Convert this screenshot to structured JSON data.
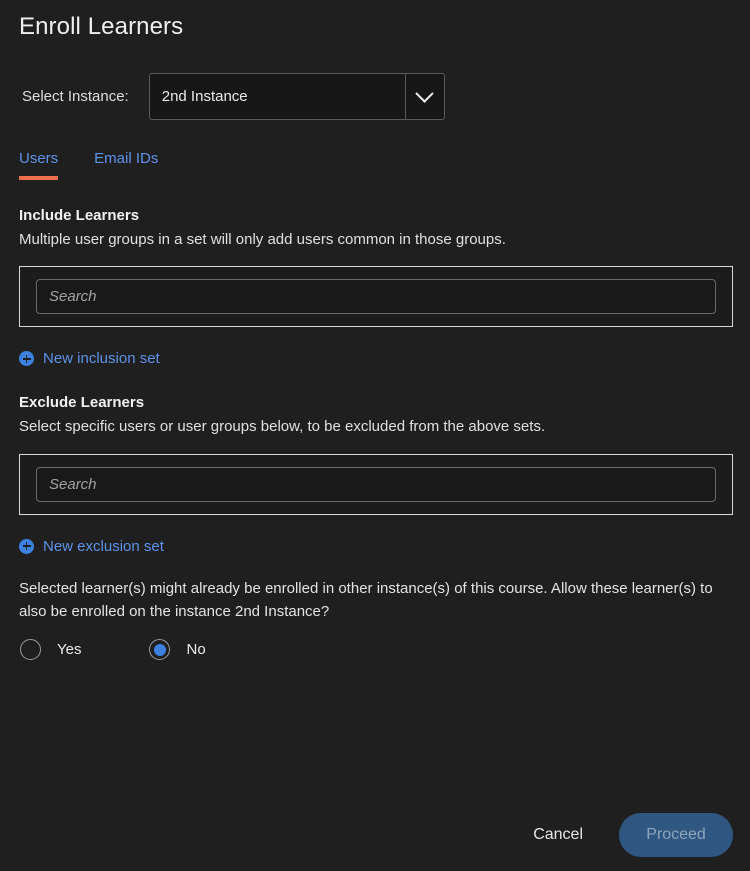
{
  "dialog": {
    "title": "Enroll Learners"
  },
  "instance": {
    "label": "Select Instance:",
    "selected": "2nd Instance",
    "chevron_icon": "chevron-down-icon"
  },
  "tabs": [
    {
      "label": "Users",
      "active": true
    },
    {
      "label": "Email IDs",
      "active": false
    }
  ],
  "include": {
    "title": "Include Learners",
    "description": "Multiple user groups in a set will only add users common in those groups.",
    "search_value": "",
    "search_placeholder": "Search",
    "new_set_label": "New inclusion set",
    "new_set_icon": "plus-circle-icon"
  },
  "exclude": {
    "title": "Exclude Learners",
    "description": "Select specific users or user groups below, to be excluded from the above sets.",
    "search_value": "",
    "search_placeholder": "Search",
    "new_set_label": "New exclusion set",
    "new_set_icon": "plus-circle-icon"
  },
  "note": {
    "text": "Selected learner(s) might already be enrolled in other instance(s) of this course. Allow these learner(s) to also be enrolled on the instance 2nd Instance?",
    "options": [
      {
        "label": "Yes",
        "selected": false
      },
      {
        "label": "No",
        "selected": true
      }
    ]
  },
  "footer": {
    "cancel_label": "Cancel",
    "proceed_label": "Proceed"
  },
  "colors": {
    "background": "#1f1f1f",
    "accent_tab_underline": "#f26f4e",
    "link_blue": "#5d93e8",
    "radio_blue": "#3b82e0",
    "proceed_button": "#2f5781"
  }
}
